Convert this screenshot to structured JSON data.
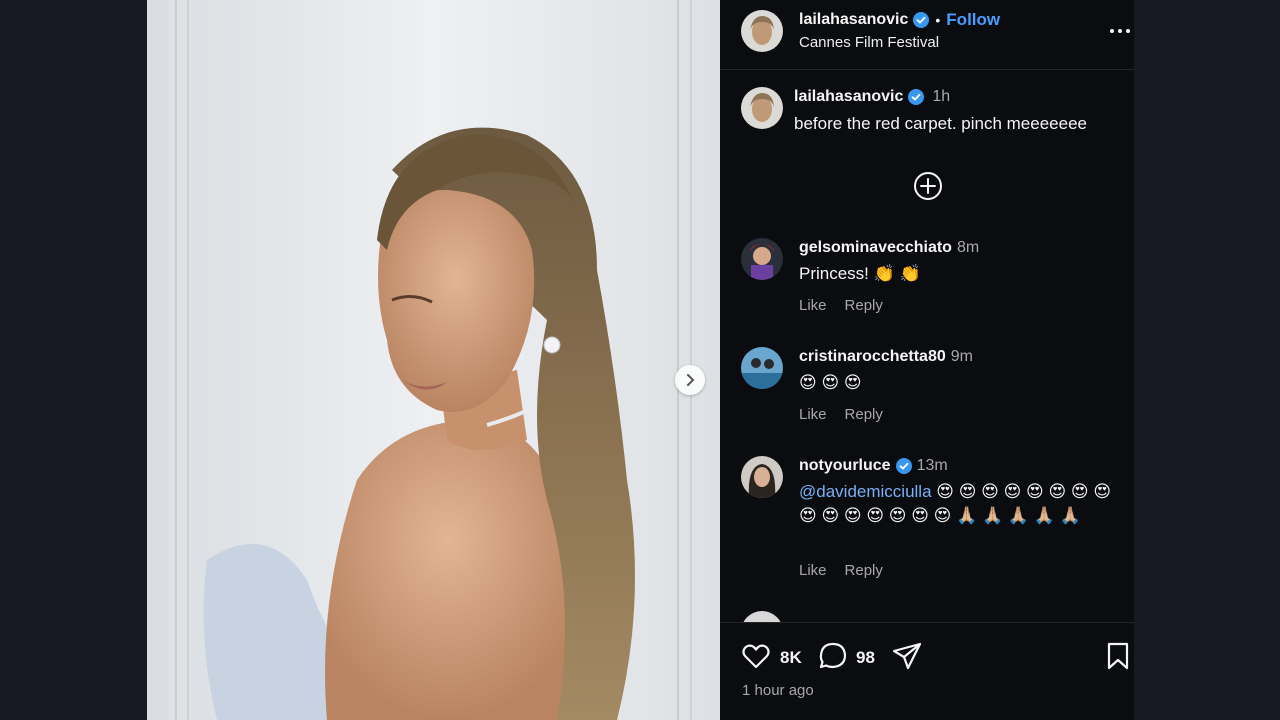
{
  "post": {
    "author": "lailahasanovic",
    "follow_label": "Follow",
    "separator": "•",
    "location": "Cannes Film Festival"
  },
  "caption": {
    "author": "lailahasanovic",
    "time": "1h",
    "text": "before the red carpet. pinch meeeeeee"
  },
  "comments": [
    {
      "user": "gelsominavecchiato",
      "time": "8m",
      "text": "Princess! 👏 👏",
      "like": "Like",
      "reply": "Reply"
    },
    {
      "user": "cristinarocchetta80",
      "time": "9m",
      "text": "😍 😍 😍",
      "like": "Like",
      "reply": "Reply"
    },
    {
      "user": "notyourluce",
      "time": "13m",
      "mention": "@davidemicciulla",
      "text": " 😍 😍 😍 😍 😍 😍 😍 😍 😍 😍 😍 😍 😍 😍 😍 🙏🏼 🙏🏼 🙏🏼 🙏🏼 🙏🏼",
      "like": "Like",
      "reply": "Reply"
    }
  ],
  "footer": {
    "likes": "8K",
    "comments": "98",
    "time_ago": "1 hour ago"
  },
  "icons": {
    "verified": "verified-badge-icon",
    "more": "more-options-icon",
    "add": "add-circle-icon",
    "next": "chevron-right-icon",
    "like": "heart-icon",
    "comment": "comment-bubble-icon",
    "share": "paper-plane-icon",
    "save": "bookmark-icon"
  },
  "colors": {
    "accent": "#4a9dff",
    "verified": "#3897f0",
    "panel_bg": "#0b0c10"
  }
}
